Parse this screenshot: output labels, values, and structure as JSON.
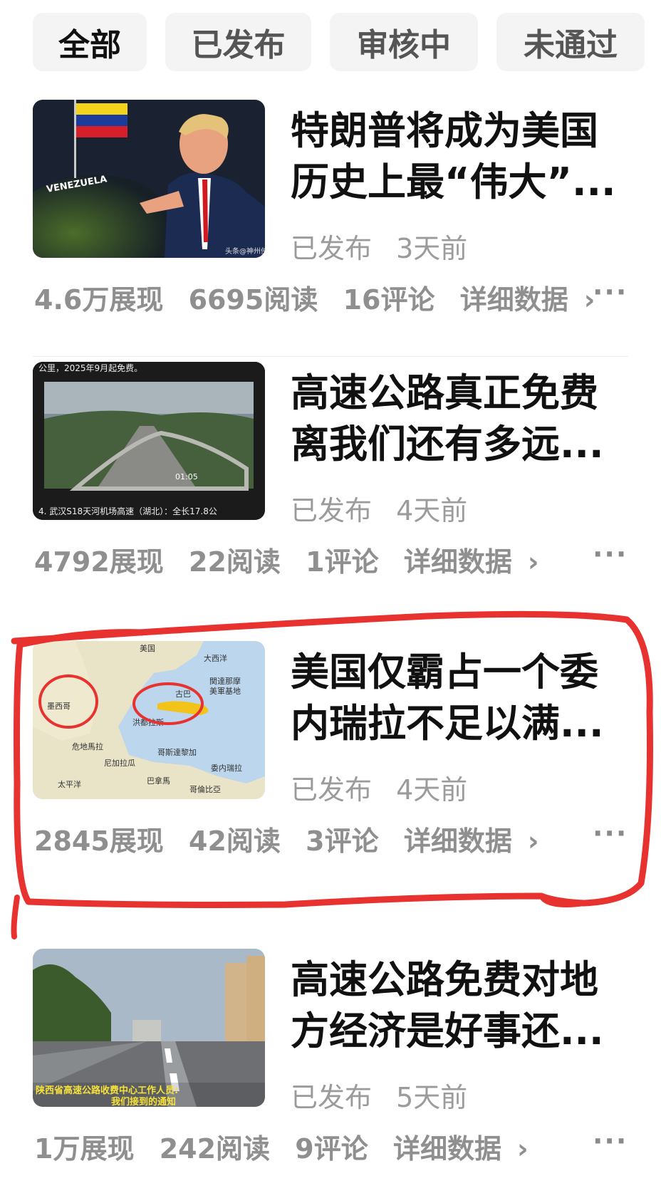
{
  "tabs": [
    {
      "label": "全部",
      "active": true
    },
    {
      "label": "已发布",
      "active": false
    },
    {
      "label": "审核中",
      "active": false
    },
    {
      "label": "未通过",
      "active": false
    }
  ],
  "articles": [
    {
      "title_line1": "特朗普将成为美国",
      "title_line2": "历史上最“伟大”...",
      "status": "已发布",
      "time": "3天前",
      "impressions": "4.6万展现",
      "reads": "6695阅读",
      "comments": "16评论",
      "detail": "详细数据",
      "thumb_text": "VENEZUELA",
      "thumb_watermark": "头条@神州侠"
    },
    {
      "title_line1": "高速公路真正免费",
      "title_line2": "离我们还有多远...",
      "status": "已发布",
      "time": "4天前",
      "impressions": "4792展现",
      "reads": "22阅读",
      "comments": "1评论",
      "detail": "详细数据",
      "thumb_top": "公里，2025年9月起免费。",
      "thumb_bottom": "4. 武汉S18天河机场高速（湖北）：全长17.8公",
      "thumb_time": "01:05"
    },
    {
      "title_line1": "美国仅霸占一个委",
      "title_line2": "内瑞拉不足以满...",
      "status": "已发布",
      "time": "4天前",
      "impressions": "2845展现",
      "reads": "42阅读",
      "comments": "3评论",
      "detail": "详细数据",
      "map_labels": [
        "美国",
        "大西洋",
        "墨西哥",
        "古巴",
        "関達那摩",
        "美軍基地",
        "危地馬拉",
        "洪都拉斯",
        "尼加拉瓜",
        "哥斯達黎加",
        "委内瑞拉",
        "太平洋",
        "巴拿馬",
        "哥倫比亞"
      ]
    },
    {
      "title_line1": "高速公路免费对地",
      "title_line2": "方经济是好事还...",
      "status": "已发布",
      "time": "5天前",
      "impressions": "1万展现",
      "reads": "242阅读",
      "comments": "9评论",
      "detail": "详细数据",
      "thumb_caption1": "陕西省高速公路收费中心工作人员:",
      "thumb_caption2": "我们接到的通知"
    }
  ],
  "colors": {
    "highlight_circle": "#e8322f",
    "title": "#111111",
    "meta": "#9b9b9b",
    "tab_bg": "#f4f4f4"
  },
  "icons": {
    "more": "more-icon",
    "chevron": "chevron-right-icon"
  },
  "more_glyph": "···",
  "chevron_glyph": "›"
}
